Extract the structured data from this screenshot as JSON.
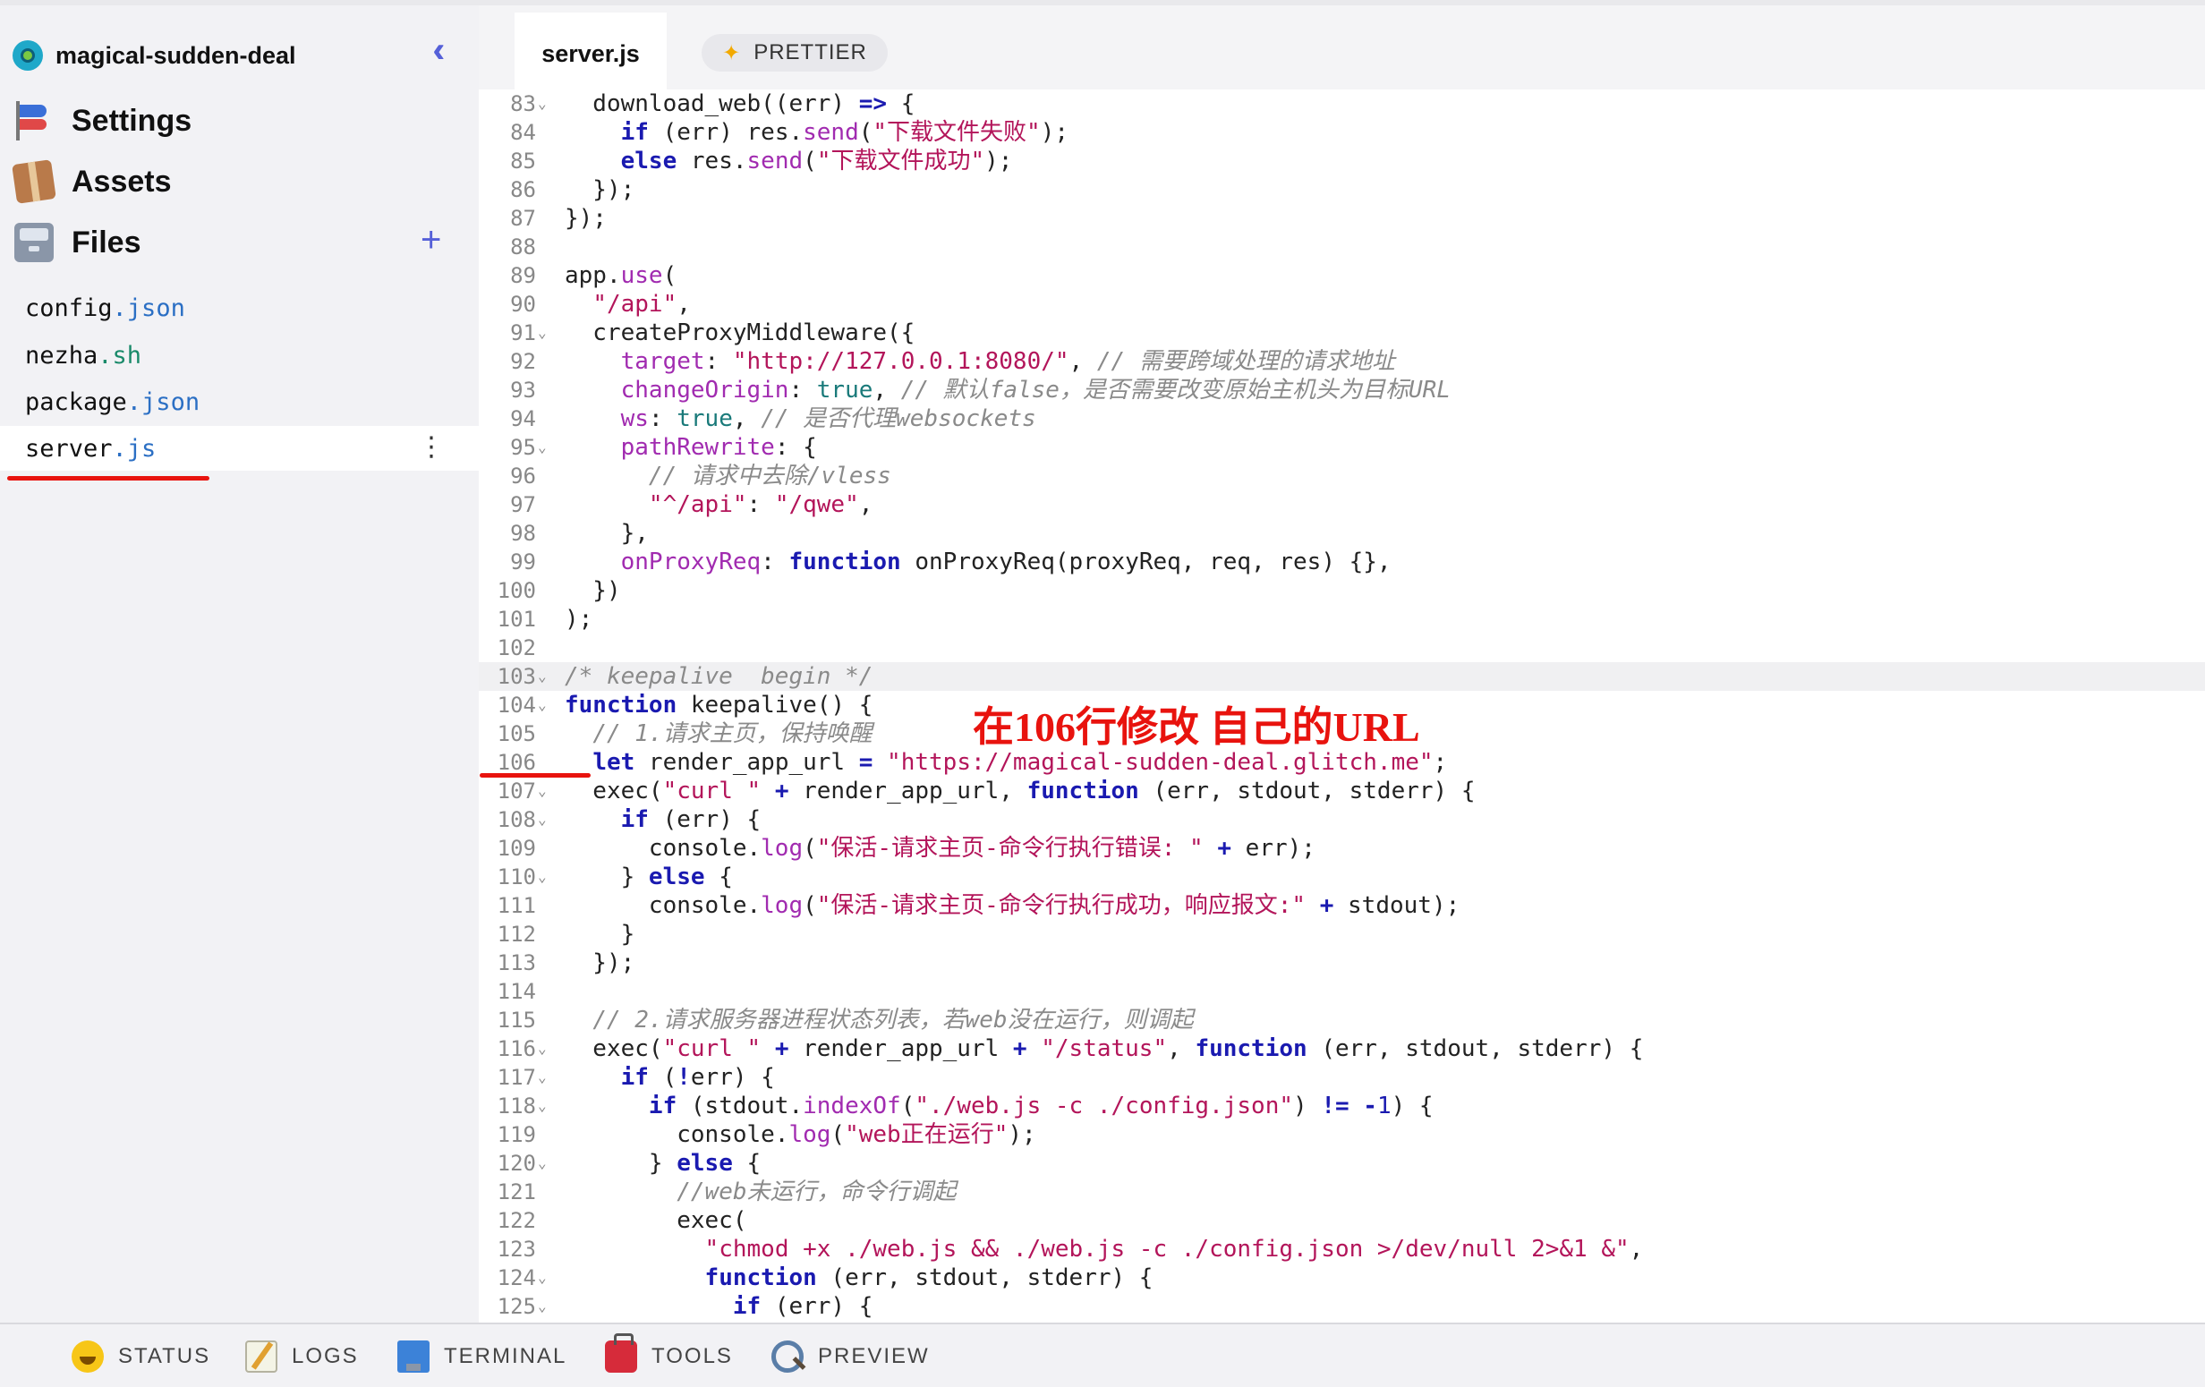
{
  "project": {
    "name": "magical-sudden-deal",
    "collapse_icon": "double-chevron-left-icon"
  },
  "nav": {
    "settings": "Settings",
    "assets": "Assets",
    "files": "Files",
    "add": "+"
  },
  "files": [
    {
      "name": "config",
      "ext": ".json"
    },
    {
      "name": "nezha",
      "ext": ".sh"
    },
    {
      "name": "package",
      "ext": ".json"
    },
    {
      "name": "server",
      "ext": ".js",
      "active": true,
      "menu": "⋮"
    }
  ],
  "tab": {
    "label": "server.js"
  },
  "prettier": {
    "icon": "✦",
    "label": "PRETTIER"
  },
  "annotation": "在106行修改 自己的URL",
  "bottom": {
    "status": "STATUS",
    "logs": "LOGS",
    "terminal": "TERMINAL",
    "tools": "TOOLS",
    "preview": "PREVIEW"
  },
  "colors": {
    "accent": "#5560d8",
    "annotation_red": "#e8130e"
  },
  "code": [
    {
      "n": "83",
      "f": true,
      "t": [
        [
          "",
          "  download_web((err) "
        ],
        [
          "kw",
          "=>"
        ],
        [
          "",
          " {"
        ]
      ]
    },
    {
      "n": "84",
      "t": [
        [
          "",
          "    "
        ],
        [
          "kw",
          "if"
        ],
        [
          "",
          " (err) res."
        ],
        [
          "prop",
          "send"
        ],
        [
          "",
          "("
        ],
        [
          "str",
          "\"下载文件失败\""
        ],
        [
          "",
          ");"
        ]
      ]
    },
    {
      "n": "85",
      "t": [
        [
          "",
          "    "
        ],
        [
          "kw",
          "else"
        ],
        [
          "",
          " res."
        ],
        [
          "prop",
          "send"
        ],
        [
          "",
          "("
        ],
        [
          "str",
          "\"下载文件成功\""
        ],
        [
          "",
          ");"
        ]
      ]
    },
    {
      "n": "86",
      "t": [
        [
          "",
          "  });"
        ]
      ]
    },
    {
      "n": "87",
      "t": [
        [
          "",
          "});"
        ]
      ]
    },
    {
      "n": "88",
      "t": []
    },
    {
      "n": "89",
      "t": [
        [
          "",
          "app."
        ],
        [
          "prop",
          "use"
        ],
        [
          "",
          "("
        ]
      ]
    },
    {
      "n": "90",
      "t": [
        [
          "",
          "  "
        ],
        [
          "str",
          "\"/api\""
        ],
        [
          "",
          ","
        ]
      ]
    },
    {
      "n": "91",
      "f": true,
      "t": [
        [
          "",
          "  createProxyMiddleware({"
        ]
      ]
    },
    {
      "n": "92",
      "t": [
        [
          "",
          "    "
        ],
        [
          "prop",
          "target"
        ],
        [
          "",
          ": "
        ],
        [
          "str",
          "\"http://127.0.0.1:8080/\""
        ],
        [
          "",
          ", "
        ],
        [
          "cm",
          "// 需要跨域处理的请求地址"
        ]
      ]
    },
    {
      "n": "93",
      "t": [
        [
          "",
          "    "
        ],
        [
          "prop",
          "changeOrigin"
        ],
        [
          "",
          ": "
        ],
        [
          "bool",
          "true"
        ],
        [
          "",
          ", "
        ],
        [
          "cm",
          "// 默认false，是否需要改变原始主机头为目标URL"
        ]
      ]
    },
    {
      "n": "94",
      "t": [
        [
          "",
          "    "
        ],
        [
          "prop",
          "ws"
        ],
        [
          "",
          ": "
        ],
        [
          "bool",
          "true"
        ],
        [
          "",
          ", "
        ],
        [
          "cm",
          "// 是否代理websockets"
        ]
      ]
    },
    {
      "n": "95",
      "f": true,
      "t": [
        [
          "",
          "    "
        ],
        [
          "prop",
          "pathRewrite"
        ],
        [
          "",
          ": {"
        ]
      ]
    },
    {
      "n": "96",
      "t": [
        [
          "",
          "      "
        ],
        [
          "cm",
          "// 请求中去除/vless"
        ]
      ]
    },
    {
      "n": "97",
      "t": [
        [
          "",
          "      "
        ],
        [
          "str",
          "\"^/api\""
        ],
        [
          "",
          ": "
        ],
        [
          "str",
          "\"/qwe\""
        ],
        [
          "",
          ","
        ]
      ]
    },
    {
      "n": "98",
      "t": [
        [
          "",
          "    },"
        ]
      ]
    },
    {
      "n": "99",
      "t": [
        [
          "",
          "    "
        ],
        [
          "prop",
          "onProxyReq"
        ],
        [
          "",
          ": "
        ],
        [
          "kw",
          "function"
        ],
        [
          "",
          " onProxyReq(proxyReq, req, res) {},"
        ]
      ]
    },
    {
      "n": "100",
      "t": [
        [
          "",
          "  })"
        ]
      ]
    },
    {
      "n": "101",
      "t": [
        [
          "",
          ");"
        ]
      ]
    },
    {
      "n": "102",
      "t": []
    },
    {
      "n": "103",
      "f": true,
      "hl": true,
      "t": [
        [
          "cm",
          "/* keepalive  begin */"
        ]
      ]
    },
    {
      "n": "104",
      "f": true,
      "t": [
        [
          "kw",
          "function"
        ],
        [
          "",
          " keepalive() {"
        ]
      ]
    },
    {
      "n": "105",
      "t": [
        [
          "",
          "  "
        ],
        [
          "cm",
          "// 1.请求主页，保持唤醒"
        ]
      ]
    },
    {
      "n": "106",
      "t": [
        [
          "",
          "  "
        ],
        [
          "kw",
          "let"
        ],
        [
          "",
          " render_app_url "
        ],
        [
          "kw",
          "="
        ],
        [
          "",
          " "
        ],
        [
          "str",
          "\"https://magical-sudden-deal.glitch.me\""
        ],
        [
          "",
          ";"
        ]
      ]
    },
    {
      "n": "107",
      "f": true,
      "t": [
        [
          "",
          "  exec("
        ],
        [
          "str",
          "\"curl \""
        ],
        [
          "",
          " "
        ],
        [
          "kw",
          "+"
        ],
        [
          "",
          " render_app_url, "
        ],
        [
          "kw",
          "function"
        ],
        [
          "",
          " (err, stdout, stderr) {"
        ]
      ]
    },
    {
      "n": "108",
      "f": true,
      "t": [
        [
          "",
          "    "
        ],
        [
          "kw",
          "if"
        ],
        [
          "",
          " (err) {"
        ]
      ]
    },
    {
      "n": "109",
      "t": [
        [
          "",
          "      console."
        ],
        [
          "prop",
          "log"
        ],
        [
          "",
          "("
        ],
        [
          "str",
          "\"保活-请求主页-命令行执行错误: \""
        ],
        [
          "",
          " "
        ],
        [
          "kw",
          "+"
        ],
        [
          "",
          " err);"
        ]
      ]
    },
    {
      "n": "110",
      "f": true,
      "t": [
        [
          "",
          "    } "
        ],
        [
          "kw",
          "else"
        ],
        [
          "",
          " {"
        ]
      ]
    },
    {
      "n": "111",
      "t": [
        [
          "",
          "      console."
        ],
        [
          "prop",
          "log"
        ],
        [
          "",
          "("
        ],
        [
          "str",
          "\"保活-请求主页-命令行执行成功，响应报文:\""
        ],
        [
          "",
          " "
        ],
        [
          "kw",
          "+"
        ],
        [
          "",
          " stdout);"
        ]
      ]
    },
    {
      "n": "112",
      "t": [
        [
          "",
          "    }"
        ]
      ]
    },
    {
      "n": "113",
      "t": [
        [
          "",
          "  });"
        ]
      ]
    },
    {
      "n": "114",
      "t": []
    },
    {
      "n": "115",
      "t": [
        [
          "",
          "  "
        ],
        [
          "cm",
          "// 2.请求服务器进程状态列表，若web没在运行，则调起"
        ]
      ]
    },
    {
      "n": "116",
      "f": true,
      "t": [
        [
          "",
          "  exec("
        ],
        [
          "str",
          "\"curl \""
        ],
        [
          "",
          " "
        ],
        [
          "kw",
          "+"
        ],
        [
          "",
          " render_app_url "
        ],
        [
          "kw",
          "+"
        ],
        [
          "",
          " "
        ],
        [
          "str",
          "\"/status\""
        ],
        [
          "",
          ", "
        ],
        [
          "kw",
          "function"
        ],
        [
          "",
          " (err, stdout, stderr) {"
        ]
      ]
    },
    {
      "n": "117",
      "f": true,
      "t": [
        [
          "",
          "    "
        ],
        [
          "kw",
          "if"
        ],
        [
          "",
          " ("
        ],
        [
          "kw",
          "!"
        ],
        [
          "",
          "err) {"
        ]
      ]
    },
    {
      "n": "118",
      "f": true,
      "t": [
        [
          "",
          "      "
        ],
        [
          "kw",
          "if"
        ],
        [
          "",
          " (stdout."
        ],
        [
          "prop",
          "indexOf"
        ],
        [
          "",
          "("
        ],
        [
          "str",
          "\"./web.js -c ./config.json\""
        ],
        [
          "",
          ") "
        ],
        [
          "kw",
          "!="
        ],
        [
          "",
          " "
        ],
        [
          "kw",
          "-"
        ],
        [
          "num",
          "1"
        ],
        [
          "",
          ") {"
        ]
      ]
    },
    {
      "n": "119",
      "t": [
        [
          "",
          "        console."
        ],
        [
          "prop",
          "log"
        ],
        [
          "",
          "("
        ],
        [
          "str",
          "\"web正在运行\""
        ],
        [
          "",
          ");"
        ]
      ]
    },
    {
      "n": "120",
      "f": true,
      "t": [
        [
          "",
          "      } "
        ],
        [
          "kw",
          "else"
        ],
        [
          "",
          " {"
        ]
      ]
    },
    {
      "n": "121",
      "t": [
        [
          "",
          "        "
        ],
        [
          "cm",
          "//web未运行，命令行调起"
        ]
      ]
    },
    {
      "n": "122",
      "t": [
        [
          "",
          "        exec("
        ]
      ]
    },
    {
      "n": "123",
      "t": [
        [
          "",
          "          "
        ],
        [
          "str",
          "\"chmod +x ./web.js && ./web.js -c ./config.json >/dev/null 2>&1 &\""
        ],
        [
          "",
          ","
        ]
      ]
    },
    {
      "n": "124",
      "f": true,
      "t": [
        [
          "",
          "          "
        ],
        [
          "kw",
          "function"
        ],
        [
          "",
          " (err, stdout, stderr) {"
        ]
      ]
    },
    {
      "n": "125",
      "f": true,
      "t": [
        [
          "",
          "            "
        ],
        [
          "kw",
          "if"
        ],
        [
          "",
          " (err) {"
        ]
      ]
    }
  ]
}
